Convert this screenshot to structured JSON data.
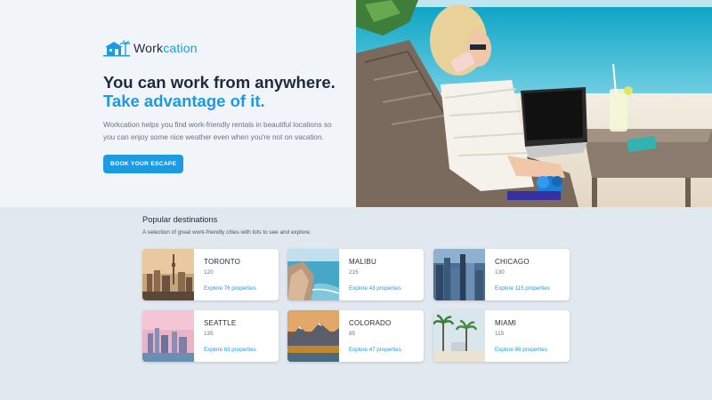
{
  "brand": {
    "name_part1": "Work",
    "name_part2": "cation"
  },
  "hero": {
    "headline_line1": "You can work from anywhere.",
    "headline_line2": "Take advantage of it.",
    "description": "Workcation helps you find work-friendly rentals in beautiful locations so you can enjoy some nice weather even when you're not on vacation.",
    "cta_label": "BOOK YOUR ESCAPE"
  },
  "popular": {
    "title": "Popular destinations",
    "subtitle": "A selection of great work-friendly cities with lots to see and explore.",
    "cards": [
      {
        "city": "TORONTO",
        "price": "120",
        "link": "Explore 76 properties"
      },
      {
        "city": "MALIBU",
        "price": "215",
        "link": "Explore 43 properties"
      },
      {
        "city": "CHICAGO",
        "price": "130",
        "link": "Explore 115 properties"
      },
      {
        "city": "SEATTLE",
        "price": "135",
        "link": "Explore 63 properties"
      },
      {
        "city": "COLORADO",
        "price": "85",
        "link": "Explore 47 properties"
      },
      {
        "city": "MIAMI",
        "price": "115",
        "link": "Explore 86 properties"
      }
    ]
  },
  "colors": {
    "accent": "#1d9be0",
    "text": "#1e293b",
    "hero_bg": "#f1f5f9",
    "page_bg": "#e2e8f0"
  }
}
